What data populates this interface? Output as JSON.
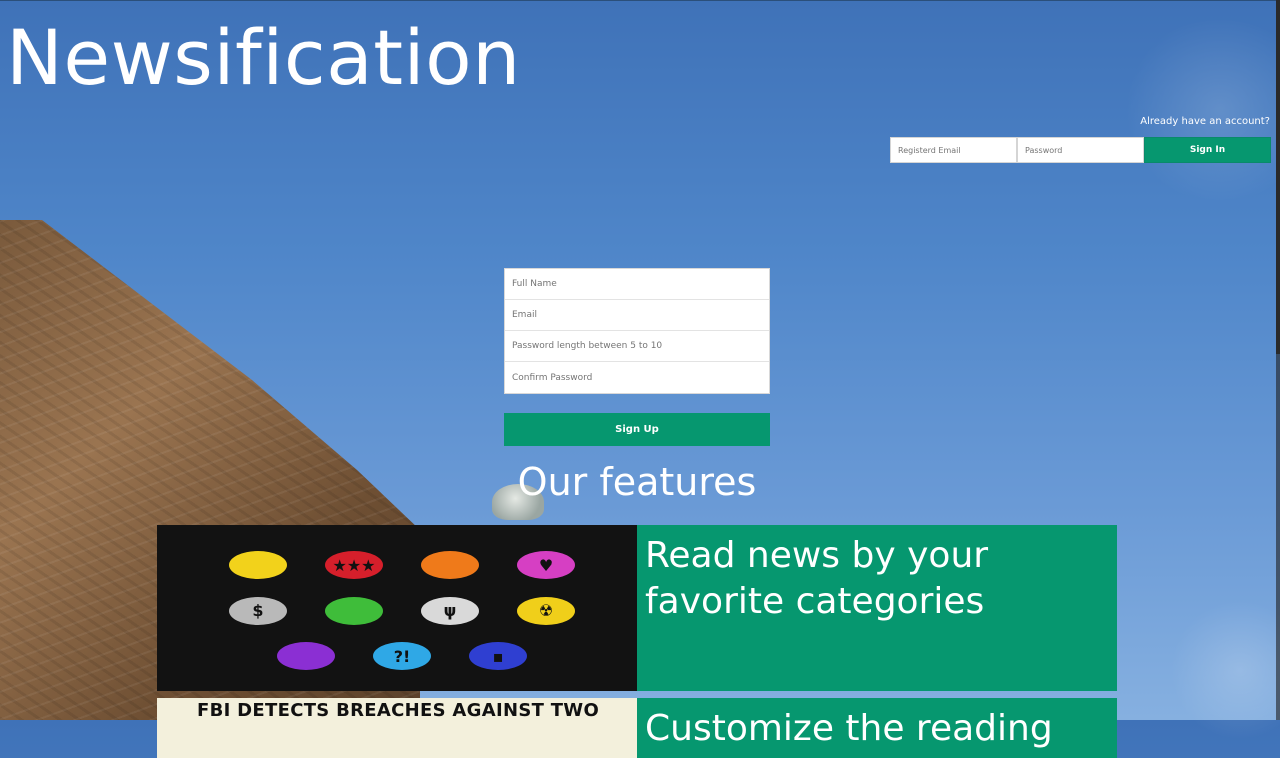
{
  "app": {
    "logo_text": "Newsification"
  },
  "signin": {
    "prompt": "Already have an account?",
    "email_placeholder": "Registerd Email",
    "password_placeholder": "Password",
    "button_label": "Sign In"
  },
  "signup": {
    "fullname_placeholder": "Full Name",
    "email_placeholder": "Email",
    "password_placeholder": "Password length between 5 to 10",
    "confirm_placeholder": "Confirm Password",
    "button_label": "Sign Up"
  },
  "features": {
    "title": "Our features",
    "items": [
      {
        "text": "Read news by your favorite categories",
        "icons": [
          {
            "name": "pacman-icon",
            "color": "#f2d21b",
            "glyph": ""
          },
          {
            "name": "stars-badge-icon",
            "color": "#d61f2b",
            "glyph": "★★★"
          },
          {
            "name": "basketball-icon",
            "color": "#ef7a1a",
            "glyph": ""
          },
          {
            "name": "heart-icon",
            "color": "#d63fc3",
            "glyph": "♥"
          },
          {
            "name": "dollar-icon",
            "color": "#b9b9b9",
            "glyph": "$"
          },
          {
            "name": "globe-icon",
            "color": "#3fbd3a",
            "glyph": ""
          },
          {
            "name": "fork-knife-icon",
            "color": "#d9d9d9",
            "glyph": "ψ"
          },
          {
            "name": "radiation-icon",
            "color": "#f0cf1a",
            "glyph": "☢"
          },
          {
            "name": "feather-icon",
            "color": "#8b2fd3",
            "glyph": ""
          },
          {
            "name": "question-exclaim-icon",
            "color": "#2fa8e6",
            "glyph": "?!"
          },
          {
            "name": "chip-icon",
            "color": "#2f3fd1",
            "glyph": "▪"
          }
        ]
      },
      {
        "text": "Customize the reading",
        "headline": "FBI DETECTS BREACHES AGAINST TWO"
      }
    ]
  },
  "colors": {
    "accent": "#06976f",
    "sky": "#4f86c9",
    "feature_image_bg": "#121212"
  }
}
